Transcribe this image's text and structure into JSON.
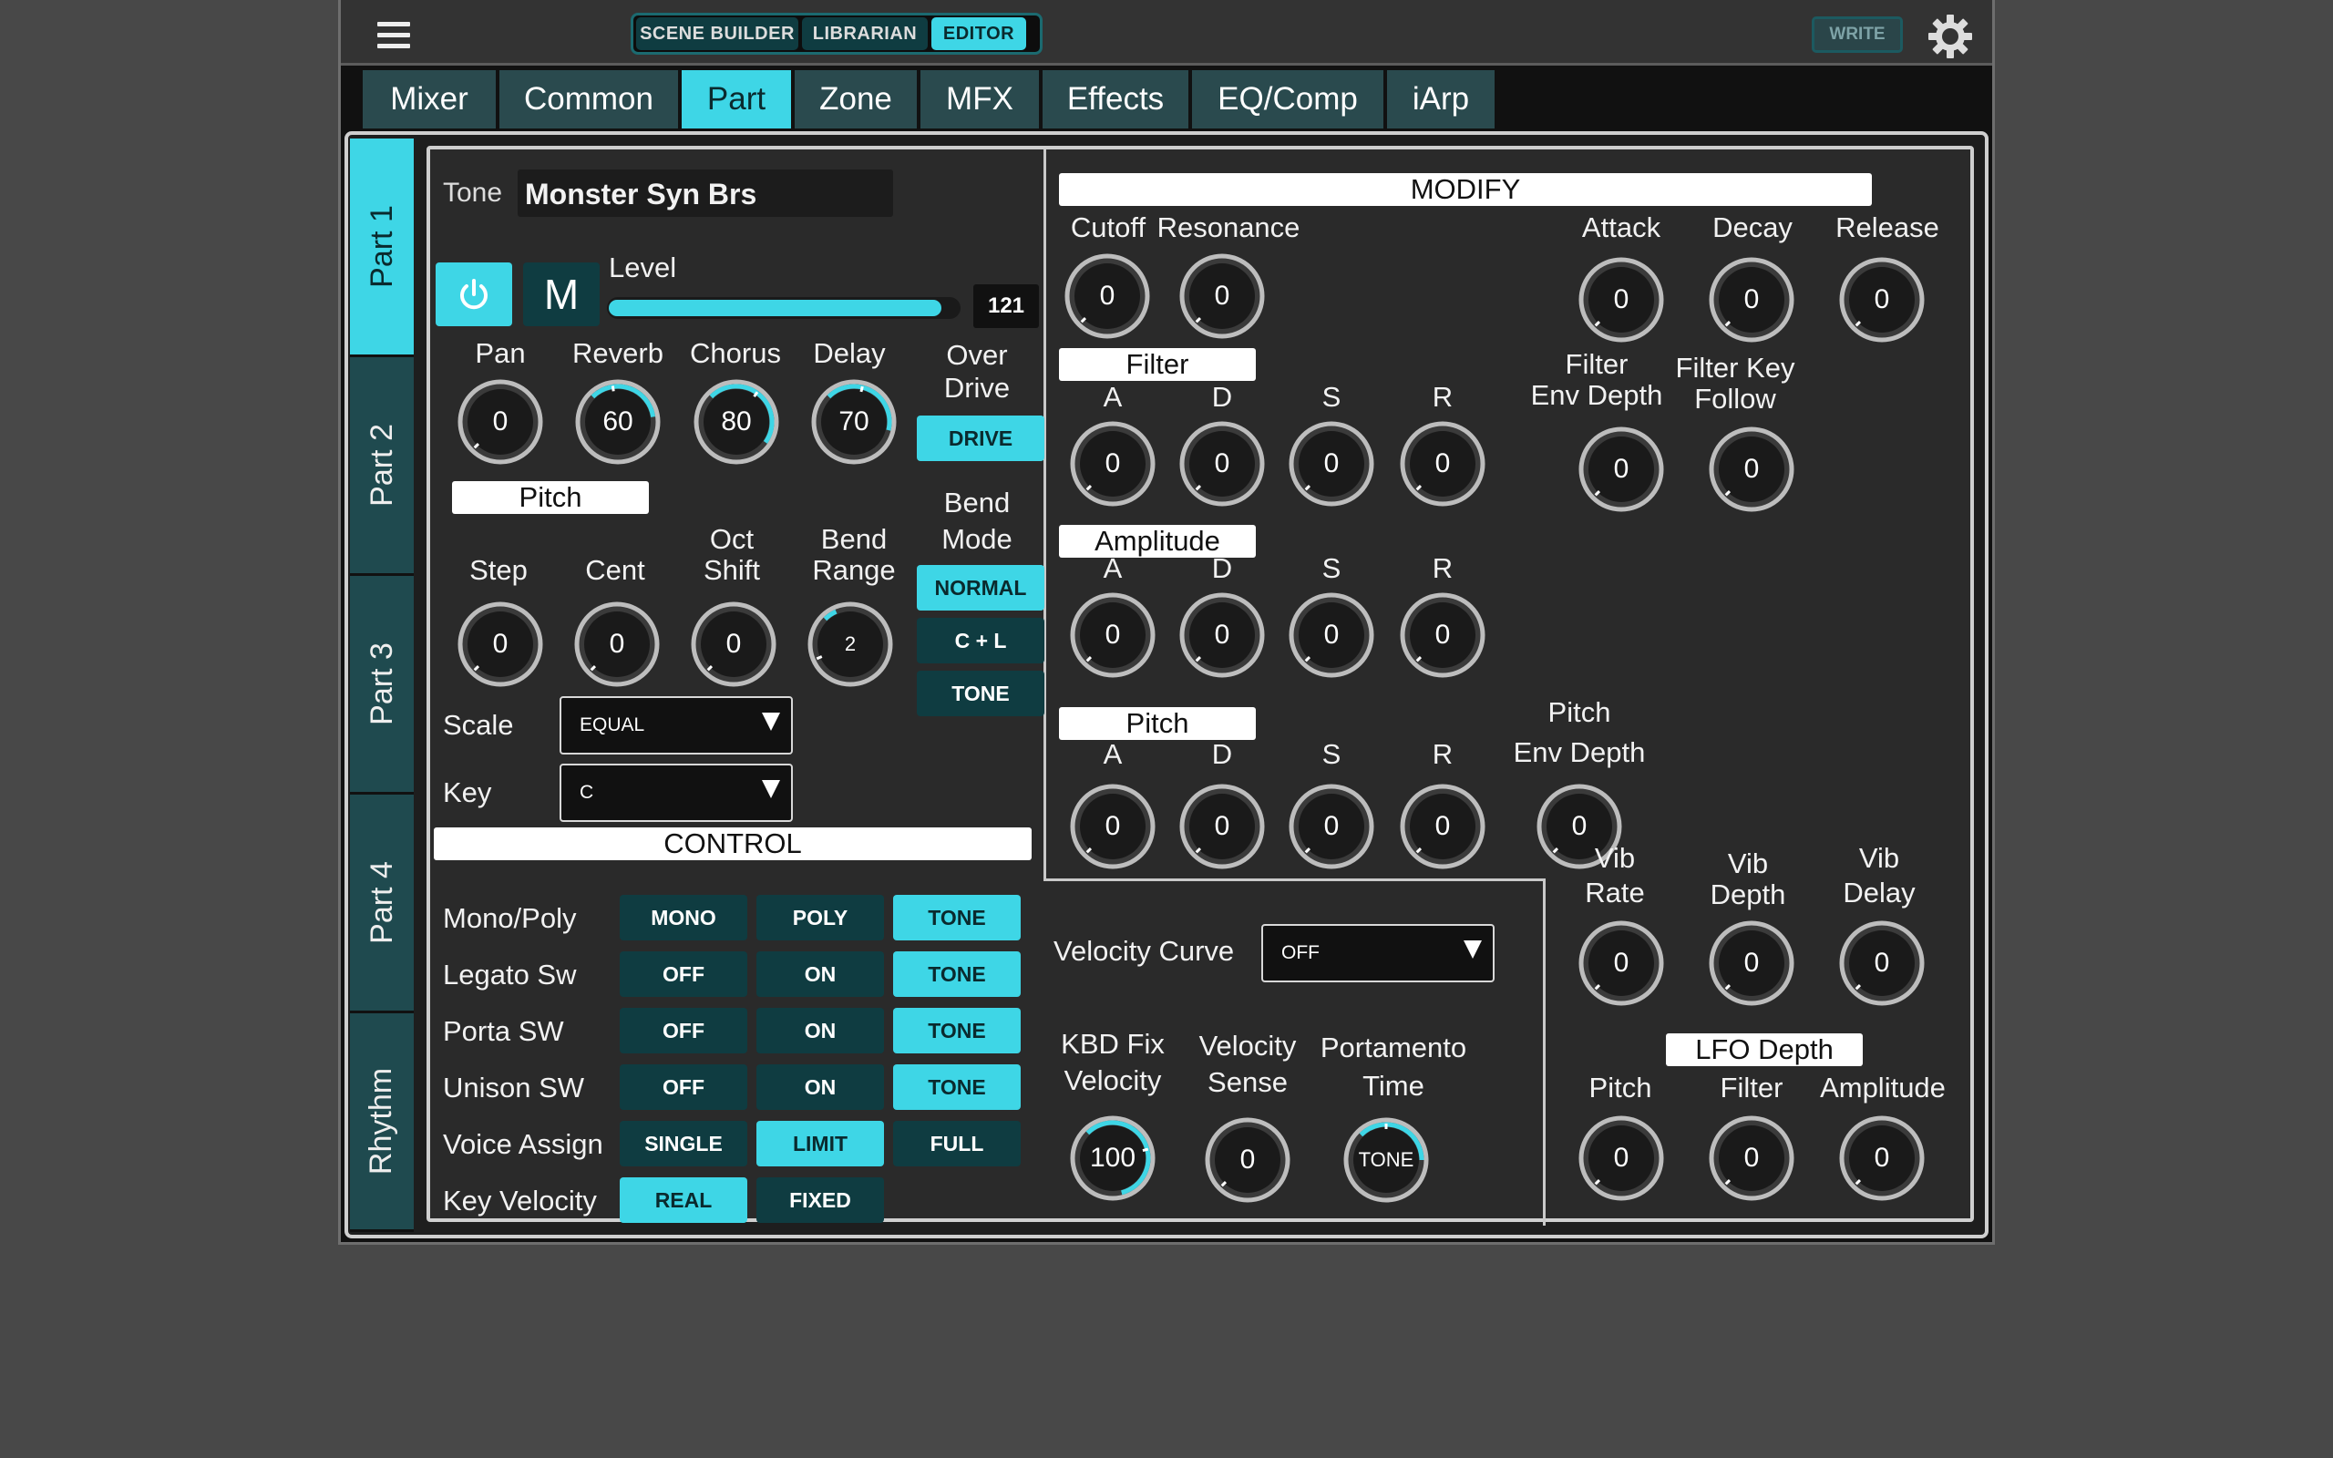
{
  "topbar": {
    "modes": [
      {
        "label": "SCENE BUILDER",
        "active": false
      },
      {
        "label": "LIBRARIAN",
        "active": false
      },
      {
        "label": "EDITOR",
        "active": true
      }
    ],
    "write_label": "WRITE"
  },
  "tabs": [
    {
      "label": "Mixer",
      "active": false
    },
    {
      "label": "Common",
      "active": false
    },
    {
      "label": "Part",
      "active": true
    },
    {
      "label": "Zone",
      "active": false
    },
    {
      "label": "MFX",
      "active": false
    },
    {
      "label": "Effects",
      "active": false
    },
    {
      "label": "EQ/Comp",
      "active": false
    },
    {
      "label": "iArp",
      "active": false
    }
  ],
  "parts": [
    {
      "label": "Part 1",
      "active": true
    },
    {
      "label": "Part 2",
      "active": false
    },
    {
      "label": "Part 3",
      "active": false
    },
    {
      "label": "Part 4",
      "active": false
    },
    {
      "label": "Rhythm",
      "active": false
    }
  ],
  "tone": {
    "label": "Tone",
    "name": "Monster Syn Brs"
  },
  "power_icon": "power-icon",
  "mute_label": "M",
  "level": {
    "label": "Level",
    "value": "121",
    "fraction": 0.95
  },
  "effects": {
    "pan": {
      "label": "Pan",
      "value": "0"
    },
    "reverb": {
      "label": "Reverb",
      "value": "60"
    },
    "chorus": {
      "label": "Chorus",
      "value": "80"
    },
    "delay": {
      "label": "Delay",
      "value": "70"
    },
    "overdrive_label_1": "Over",
    "overdrive_label_2": "Drive",
    "drive_button": "DRIVE"
  },
  "pitch": {
    "header": "Pitch",
    "step": {
      "label": "Step",
      "value": "0"
    },
    "cent": {
      "label": "Cent",
      "value": "0"
    },
    "oct_label_1": "Oct",
    "oct_label_2": "Shift",
    "oct_value": "0",
    "bend_label_1": "Bend",
    "bend_label_2": "Range",
    "bend_value": "2",
    "bend_mode_1": "Bend",
    "bend_mode_2": "Mode",
    "bend_modes": [
      "NORMAL",
      "C + L",
      "TONE"
    ]
  },
  "scale": {
    "label": "Scale",
    "value": "EQUAL"
  },
  "key": {
    "label": "Key",
    "value": "C"
  },
  "control": {
    "header": "CONTROL",
    "rows": [
      {
        "label": "Mono/Poly",
        "buttons": [
          "MONO",
          "POLY",
          "TONE"
        ]
      },
      {
        "label": "Legato Sw",
        "buttons": [
          "OFF",
          "ON",
          "TONE"
        ]
      },
      {
        "label": "Porta SW",
        "buttons": [
          "OFF",
          "ON",
          "TONE"
        ]
      },
      {
        "label": "Unison SW",
        "buttons": [
          "OFF",
          "ON",
          "TONE"
        ]
      },
      {
        "label": "Voice Assign",
        "buttons": [
          "SINGLE",
          "LIMIT",
          "FULL"
        ]
      },
      {
        "label": "Key Velocity",
        "buttons": [
          "REAL",
          "FIXED"
        ]
      }
    ]
  },
  "modify": {
    "header": "MODIFY",
    "cutoff": {
      "label": "Cutoff",
      "value": "0"
    },
    "resonance": {
      "label": "Resonance",
      "value": "0"
    },
    "attack": {
      "label": "Attack",
      "value": "0"
    },
    "decay": {
      "label": "Decay",
      "value": "0"
    },
    "release": {
      "label": "Release",
      "value": "0"
    },
    "filter_header": "Filter",
    "filter_env": [
      "0",
      "0",
      "0",
      "0"
    ],
    "filter_env_depth_1": "Filter",
    "filter_env_depth_2": "Env Depth",
    "filter_env_depth": "0",
    "filter_key_1": "Filter Key",
    "filter_key_2": "Follow",
    "filter_key": "0",
    "amp_header": "Amplitude",
    "amp_env": [
      "0",
      "0",
      "0",
      "0"
    ],
    "pitch_header": "Pitch",
    "pitch_env": [
      "0",
      "0",
      "0",
      "0"
    ],
    "pitch_env_depth_1": "Pitch",
    "pitch_env_depth_2": "Env Depth",
    "pitch_env_depth": "0",
    "adsr": [
      "A",
      "D",
      "S",
      "R"
    ]
  },
  "velocity_curve": {
    "label": "Velocity Curve",
    "value": "OFF"
  },
  "kbd": {
    "label_1": "KBD Fix",
    "label_2": "Velocity",
    "value": "100"
  },
  "vel_sense": {
    "label_1": "Velocity",
    "label_2": "Sense",
    "value": "0"
  },
  "porta_time": {
    "label_1": "Portamento",
    "label_2": "Time",
    "value": "TONE"
  },
  "vib": {
    "rate_1": "Vib",
    "rate_2": "Rate",
    "rate": "0",
    "depth_1": "Vib",
    "depth_2": "Depth",
    "depth": "0",
    "delay_1": "Vib",
    "delay_2": "Delay",
    "delay": "0"
  },
  "lfo": {
    "header": "LFO Depth",
    "pitch": {
      "label": "Pitch",
      "value": "0"
    },
    "filter": {
      "label": "Filter",
      "value": "0"
    },
    "amplitude": {
      "label": "Amplitude",
      "value": "0"
    }
  },
  "colors": {
    "accent": "#3ed6e6",
    "dark_button": "#0f3c41",
    "panel": "#2a2a2a"
  }
}
